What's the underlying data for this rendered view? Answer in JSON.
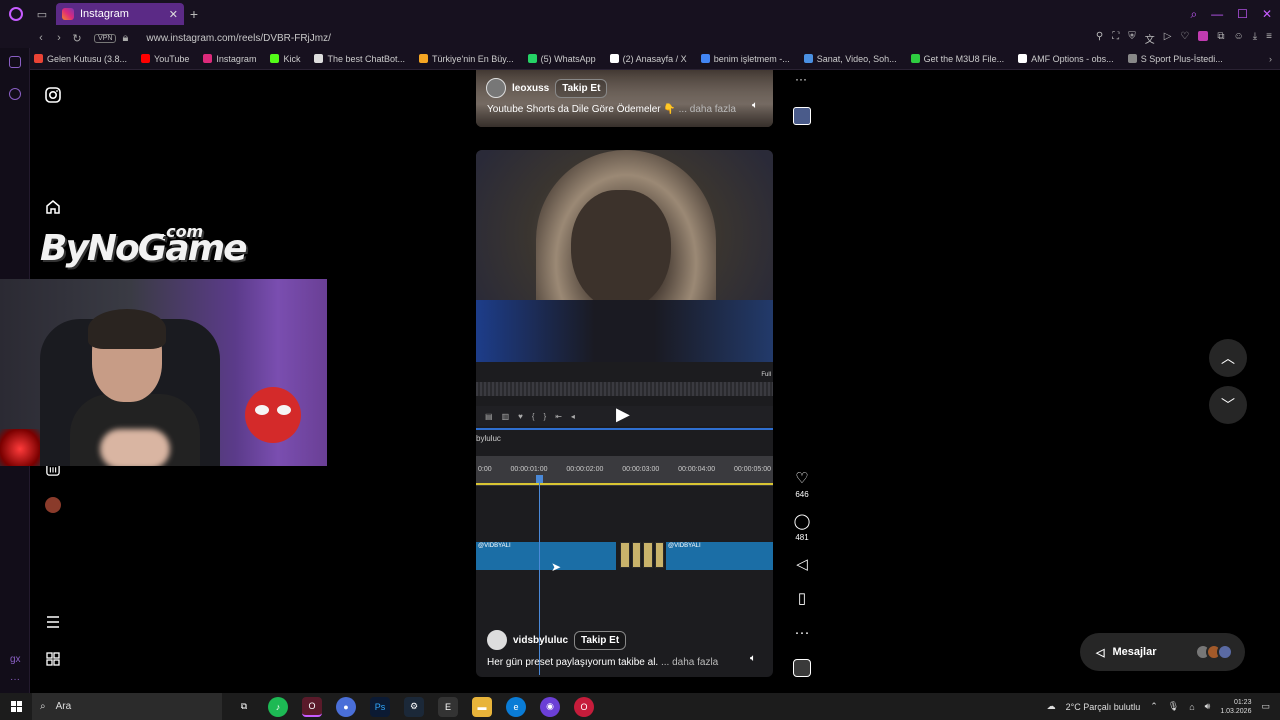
{
  "browser": {
    "tab_title": "Instagram",
    "url": "www.instagram.com/reels/DVBR-FRjJmz/",
    "vpn_label": "VPN",
    "bookmarks": [
      {
        "label": "Gelen Kutusu (3.8...",
        "color": "#ea4335"
      },
      {
        "label": "YouTube",
        "color": "#ff0000"
      },
      {
        "label": "Instagram",
        "color": "#dd2a7b"
      },
      {
        "label": "Kick",
        "color": "#53fc18"
      },
      {
        "label": "The best ChatBot...",
        "color": "#dddddd"
      },
      {
        "label": "Türkiye'nin En Büy...",
        "color": "#f5a623"
      },
      {
        "label": "(5) WhatsApp",
        "color": "#25d366"
      },
      {
        "label": "(2) Anasayfa / X",
        "color": "#ffffff"
      },
      {
        "label": "benim işletmem -...",
        "color": "#4285f4"
      },
      {
        "label": "Sanat, Video, Soh...",
        "color": "#4a90e2"
      },
      {
        "label": "Get the M3U8 File...",
        "color": "#2ecc40"
      },
      {
        "label": "AMF Options - obs...",
        "color": "#ffffff"
      },
      {
        "label": "S Sport Plus-İstedi...",
        "color": "#888888"
      }
    ]
  },
  "overlay": {
    "logo_main": "ByNoGame",
    "logo_suffix": ".com"
  },
  "reels": {
    "top": {
      "username": "leoxuss",
      "follow_label": "Takip Et",
      "caption": "Youtube Shorts da Dile Göre Ödemeler 👇",
      "more": "... daha fazla"
    },
    "main": {
      "username": "vidsbyluluc",
      "follow_label": "Takip Et",
      "caption": "Her gün preset paylaşıyorum takibe al.",
      "more": "... daha fazla",
      "video_project": "byluluc",
      "full_tag": "Full",
      "timeline_ticks": [
        "0:00",
        "00:00:01:00",
        "00:00:02:00",
        "00:00:03:00",
        "00:00:04:00",
        "00:00:05:00"
      ],
      "track_label_1": "@VIDBYALI",
      "track_label_2": "@VIDBYALI",
      "likes": "646",
      "comments": "481"
    }
  },
  "messages": {
    "label": "Mesajlar"
  },
  "taskbar": {
    "search_placeholder": "Ara",
    "weather": "2°C  Parçalı bulutlu",
    "time": "01:23",
    "date": "1.03.2026"
  }
}
